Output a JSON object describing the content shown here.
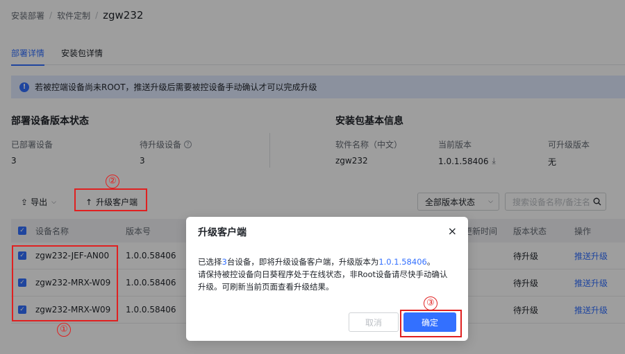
{
  "breadcrumb": {
    "item1": "安装部署",
    "item2": "软件定制",
    "current": "zgw232",
    "sep": "/"
  },
  "tabs": [
    {
      "label": "部署详情"
    },
    {
      "label": "安装包详情"
    }
  ],
  "alert": {
    "text": "若被控端设备尚未ROOT，推送升级后需要被控设备手动确认才可以完成升级"
  },
  "deploy_status": {
    "title": "部署设备版本状态",
    "deployed_label": "已部署设备",
    "deployed_value": "3",
    "pending_label": "待升级设备",
    "pending_value": "3"
  },
  "package_info": {
    "title": "安装包基本信息",
    "name_label": "软件名称（中文）",
    "name_value": "zgw232",
    "current_label": "当前版本",
    "current_value": "1.0.1.58406",
    "upgradable_label": "可升级版本",
    "upgradable_value": "无"
  },
  "toolbar": {
    "export_label": "导出",
    "upgrade_label": "升级客户端",
    "filter_value": "全部版本状态",
    "search_placeholder": "搜索设备名称/备注名"
  },
  "table": {
    "headers": {
      "name": "设备名称",
      "version": "版本号",
      "updated": "更新时间",
      "status": "版本状态",
      "action": "操作"
    },
    "rows": [
      {
        "name": "zgw232-JEF-AN00",
        "version": "1.0.0.58406",
        "status": "待升级",
        "action": "推送升级"
      },
      {
        "name": "zgw232-MRX-W09",
        "version": "1.0.0.58406",
        "status": "待升级",
        "action": "推送升级"
      },
      {
        "name": "zgw232-MRX-W09",
        "version": "1.0.0.58406",
        "status": "待升级",
        "action": "推送升级"
      }
    ]
  },
  "annotations": {
    "n1": "①",
    "n2": "②",
    "n3": "③"
  },
  "modal": {
    "title": "升级客户端",
    "close": "×",
    "line1_a": "已选择",
    "line1_count": "3",
    "line1_b": "台设备，即将升级设备客户端，升级版本为",
    "line1_version": "1.0.1.58406",
    "line1_c": "。",
    "line2": "请保持被控设备向日葵程序处于在线状态，非Root设备请尽快手动确认升级。可刷新当前页面查看升级结果。",
    "cancel_label": "取消",
    "ok_label": "确定"
  },
  "colors": {
    "accent": "#3370ff",
    "annotation": "#e02020"
  }
}
